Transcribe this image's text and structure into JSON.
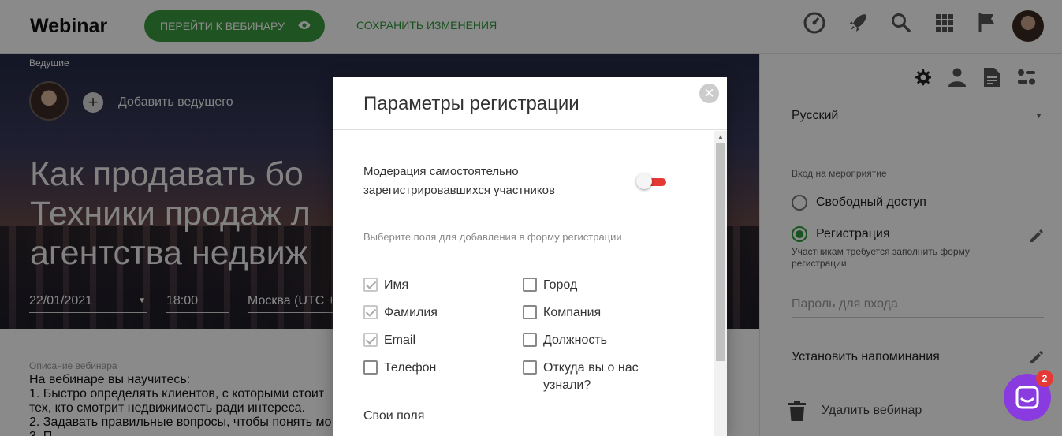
{
  "header": {
    "logo": "Webinar",
    "goto_label": "Перейти к вебинару",
    "save_label": "Сохранить изменения",
    "icons": [
      "speedometer-icon",
      "rocket-icon",
      "search-icon",
      "grid-icon",
      "flag-icon"
    ]
  },
  "hero": {
    "hosts_label": "Ведущие",
    "add_host_label": "Добавить ведущего",
    "title": "Как продавать бо\nТехники продаж л\nагентства недвиж",
    "date": "22/01/2021",
    "time": "18:00",
    "timezone": "Москва (UTC +"
  },
  "description": {
    "label": "Описание вебинара",
    "text": "На вебинаре вы научитесь:\n1. Быстро определять клиентов, с которыми стоит\nтех, кто смотрит недвижимость ради интереса.\n2. Задавать правильные вопросы, чтобы понять мо\n3. П"
  },
  "right_panel": {
    "language": "Русский",
    "entry_label": "Вход на мероприятие",
    "free_access": "Свободный доступ",
    "registration": "Регистрация",
    "registration_hint": "Участникам требуется заполнить форму регистрации",
    "password_placeholder": "Пароль для входа",
    "reminder": "Установить напоминания",
    "delete": "Удалить вебинар"
  },
  "modal": {
    "title": "Параметры регистрации",
    "moderation_label": "Модерация самостоятельно зарегистрировавшихся участников",
    "moderation_enabled": false,
    "fields_hint": "Выберите поля для добавления в форму регистрации",
    "fields_left": [
      {
        "label": "Имя",
        "checked": true
      },
      {
        "label": "Фамилия",
        "checked": true
      },
      {
        "label": "Email",
        "checked": true
      },
      {
        "label": "Телефон",
        "checked": false
      }
    ],
    "fields_right": [
      {
        "label": "Город",
        "checked": false
      },
      {
        "label": "Компания",
        "checked": false
      },
      {
        "label": "Должность",
        "checked": false
      },
      {
        "label": "Откуда вы о нас узнали?",
        "checked": false
      }
    ],
    "custom_fields_label": "Свои поля"
  },
  "chat": {
    "badge": "2"
  },
  "colors": {
    "accent_green": "#3a9a3d",
    "toggle_red": "#e53935",
    "chat_purple": "#8a3be0"
  }
}
